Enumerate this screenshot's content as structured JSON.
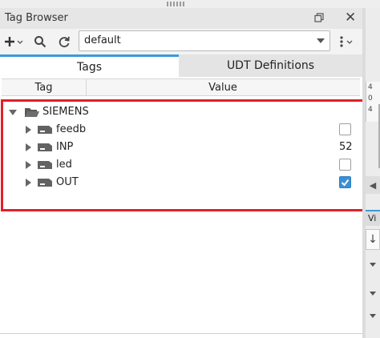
{
  "window": {
    "title": "Tag Browser"
  },
  "toolbar": {
    "add_icon": "plus-icon",
    "search_icon": "search-icon",
    "refresh_icon": "refresh-icon",
    "provider_value": "default",
    "menu_icon": "vertical-ellipsis-icon"
  },
  "tabs": [
    {
      "label": "Tags",
      "selected": true
    },
    {
      "label": "UDT Definitions",
      "selected": false
    }
  ],
  "columns": {
    "tag": "Tag",
    "value": "Value"
  },
  "tree": {
    "folder": {
      "label": "SIEMENS",
      "expanded": true
    },
    "tags": [
      {
        "label": "feedb",
        "value_type": "checkbox",
        "checked": false
      },
      {
        "label": "INP",
        "value_type": "number",
        "value": "52"
      },
      {
        "label": "led",
        "value_type": "checkbox",
        "checked": false
      },
      {
        "label": "OUT",
        "value_type": "checkbox",
        "checked": true
      }
    ]
  },
  "colors": {
    "highlight": "#e0202a",
    "accent": "#3d9ad9",
    "checked": "#3b8fd4"
  },
  "right_panel": {
    "tab_label": "Vi"
  }
}
